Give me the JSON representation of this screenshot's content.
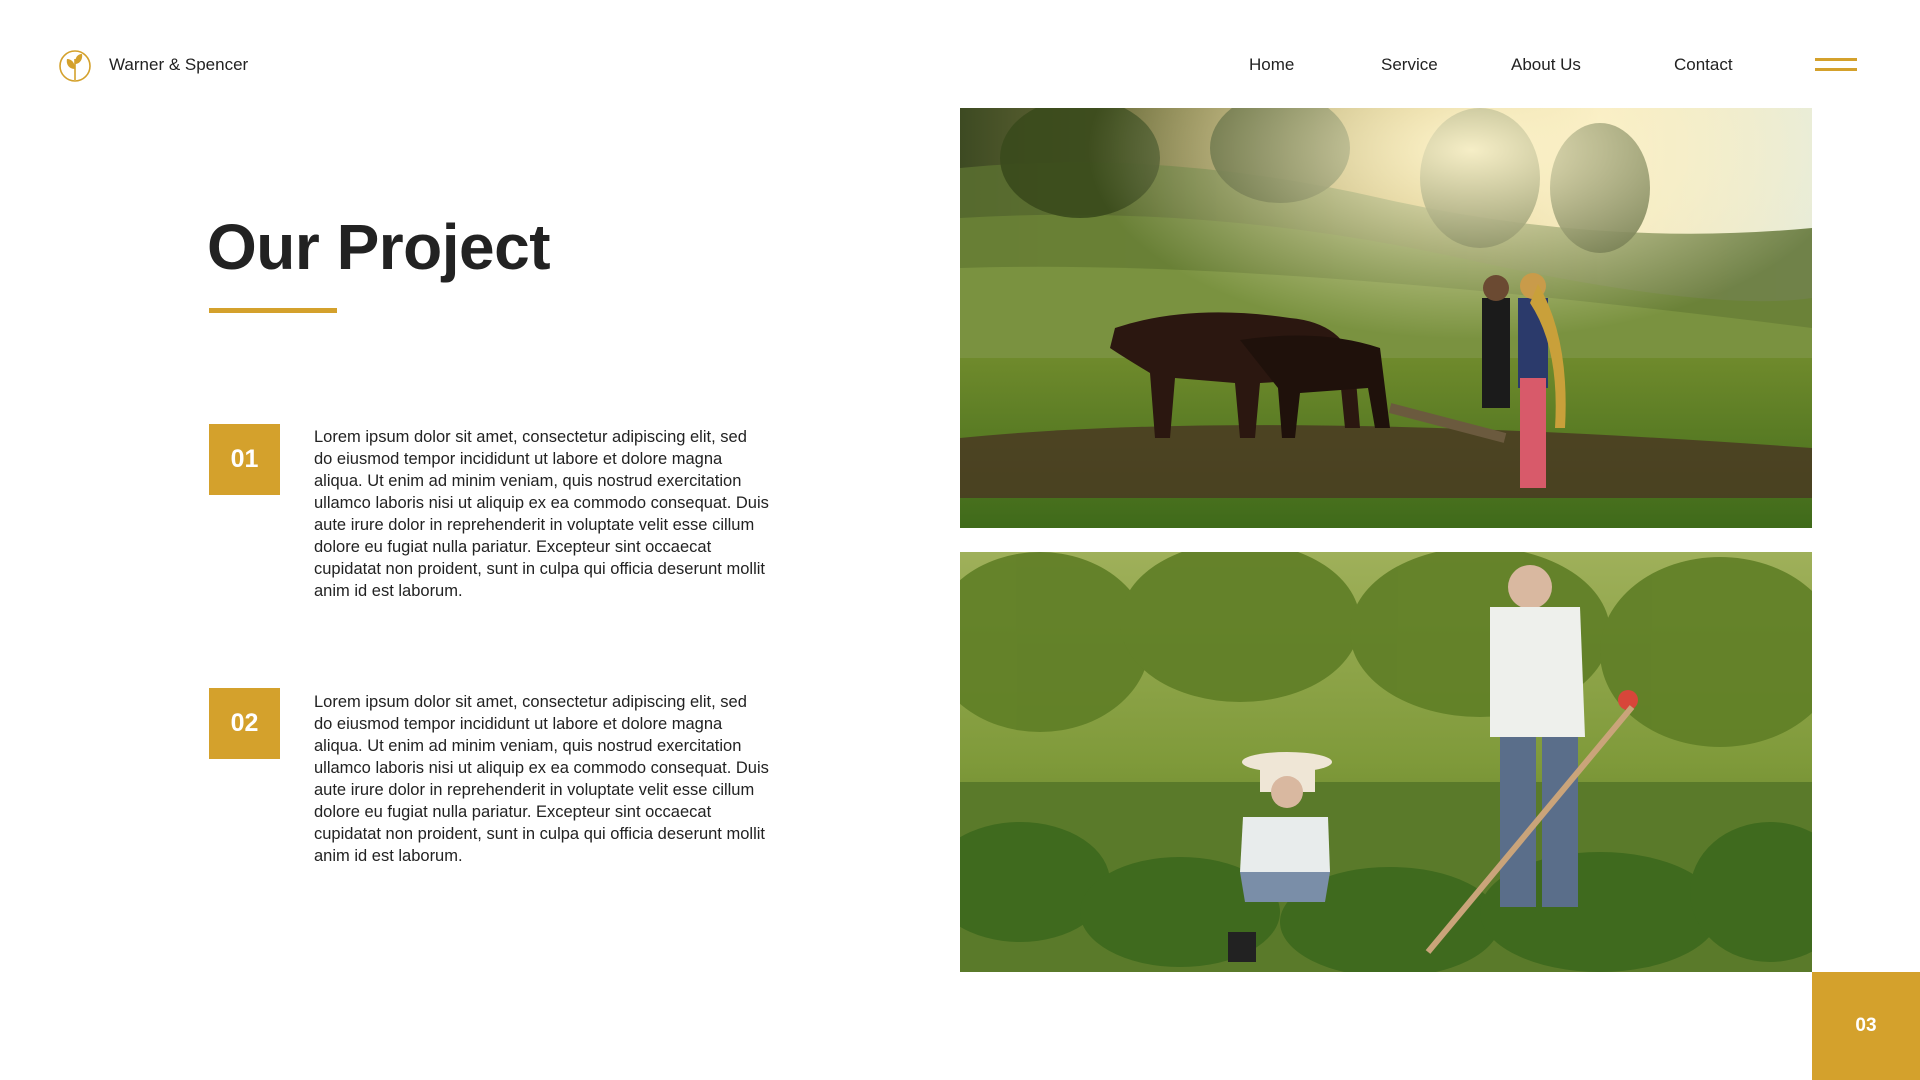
{
  "header": {
    "brand": "Warner & Spencer",
    "logo_icon": "leaf-sprout-icon",
    "nav": {
      "home": "Home",
      "service": "Service",
      "about": "About Us",
      "contact": "Contact"
    },
    "menu_icon": "hamburger-icon"
  },
  "main": {
    "title": "Our Project",
    "items": [
      {
        "number": "01",
        "text": "Lorem ipsum dolor sit amet, consectetur adipiscing elit, sed do eiusmod tempor incididunt ut labore et dolore magna aliqua. Ut enim ad minim veniam, quis nostrud exercitation ullamco laboris nisi ut aliquip ex ea commodo consequat. Duis aute irure dolor in reprehenderit in voluptate velit esse cillum dolore eu fugiat nulla pariatur. Excepteur sint occaecat cupidatat non proident, sunt in culpa qui officia deserunt mollit anim id est laborum."
      },
      {
        "number": "02",
        "text": "Lorem ipsum dolor sit amet, consectetur adipiscing elit, sed do eiusmod tempor incididunt ut labore et dolore magna aliqua. Ut enim ad minim veniam, quis nostrud exercitation ullamco laboris nisi ut aliquip ex ea commodo consequat. Duis aute irure dolor in reprehenderit in voluptate velit esse cillum dolore eu fugiat nulla pariatur. Excepteur sint occaecat cupidatat non proident, sunt in culpa qui officia deserunt mollit anim id est laborum."
      }
    ]
  },
  "page_number": "03",
  "colors": {
    "accent": "#d4a12c",
    "text": "#222222",
    "background": "#ffffff"
  }
}
